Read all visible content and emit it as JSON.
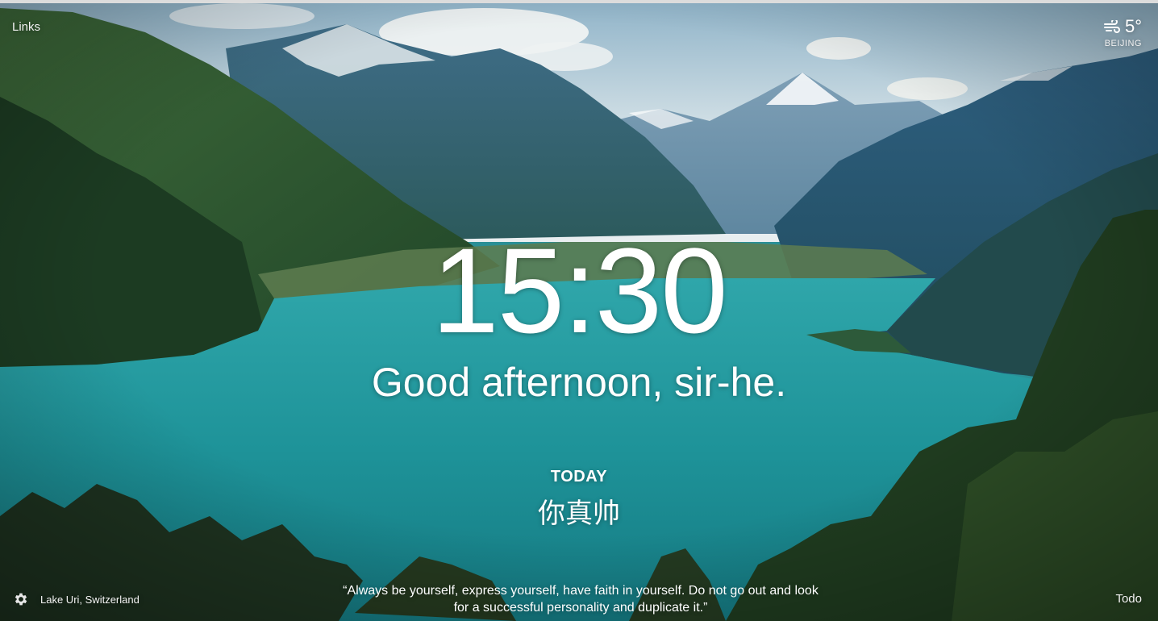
{
  "links_label": "Links",
  "weather": {
    "temperature": "5°",
    "city": "BEIJING",
    "icon": "wind-icon"
  },
  "clock": "15:30",
  "greeting": "Good afternoon, sir-he.",
  "focus": {
    "heading": "TODAY",
    "text": "你真帅"
  },
  "footer": {
    "settings_icon": "gear-icon",
    "photo_location": "Lake Uri, Switzerland",
    "quote": "“Always be yourself, express yourself, have faith in yourself. Do not go out and look for a successful personality and duplicate it.”",
    "todo_label": "Todo"
  },
  "colors": {
    "lake": "#1f9aa0",
    "sky": "#cfe0ea",
    "forest": "#1f3d26",
    "text": "#ffffff"
  }
}
